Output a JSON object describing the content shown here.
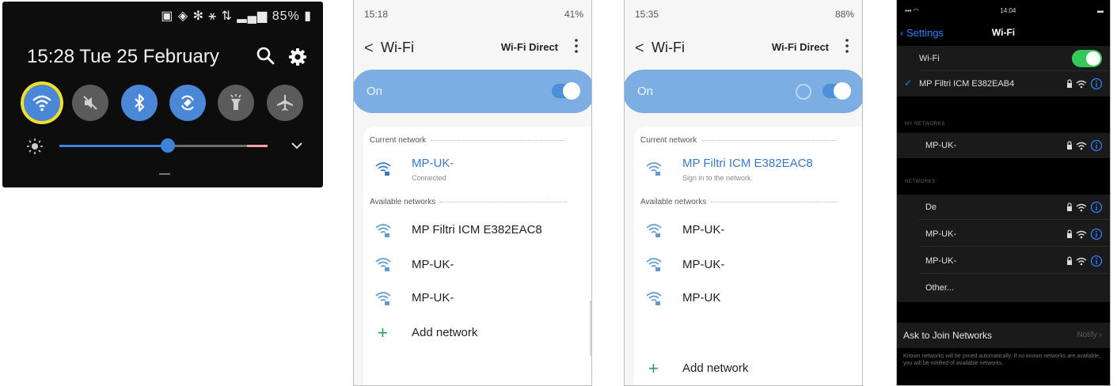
{
  "quick_settings": {
    "status": "85%",
    "time_date": "15:28  Tue 25 February",
    "brightness_level": 0.57,
    "tiles": [
      {
        "name": "wifi",
        "state": "on",
        "highlighted": true
      },
      {
        "name": "sound",
        "state": "off"
      },
      {
        "name": "bluetooth",
        "state": "on"
      },
      {
        "name": "auto-rotate",
        "state": "on"
      },
      {
        "name": "flashlight",
        "state": "off"
      },
      {
        "name": "airplane-mode",
        "state": "off"
      }
    ],
    "accent": "#4a87d6",
    "highlight": "#f3df27"
  },
  "screen_a": {
    "status_left": "15:18",
    "status_right": "41%",
    "back": "<",
    "title": "Wi-Fi",
    "wifi_direct": "Wi-Fi Direct",
    "on_label": "On",
    "current_network_header": "Current network",
    "current": {
      "name": "MP-UK-",
      "status": "Connected"
    },
    "available_header": "Available networks",
    "networks": [
      "MP Filtri ICM E382EAC8",
      "MP-UK-",
      "MP-UK-"
    ],
    "add_network": "Add network"
  },
  "screen_b": {
    "status_left": "15:35",
    "status_right": "88%",
    "back": "<",
    "title": "Wi-Fi",
    "wifi_direct": "Wi-Fi Direct",
    "on_label": "On",
    "current_network_header": "Current network",
    "current": {
      "name": "MP Filtri ICM E382EAC8",
      "status": "Sign in to the network."
    },
    "available_header": "Available networks",
    "networks": [
      "MP-UK-",
      "MP-UK-",
      "MP-UK"
    ],
    "add_network": "Add network"
  },
  "ios": {
    "status_time": "14:04",
    "back": "Settings",
    "title": "Wi-Fi",
    "wifi_label": "Wi-Fi",
    "connected": "MP Filtri ICM E382EAB4",
    "my_networks_header": "MY NETWORKS",
    "my_networks": [
      "MP-UK-"
    ],
    "networks_header": "NETWORKS",
    "networks": [
      "De",
      "MP-UK-",
      "MP-UK-",
      "Other..."
    ],
    "ask_label": "Ask to Join Networks",
    "ask_value": "Notify",
    "footer": "Known networks will be joined automatically. If no known networks are available, you will be notified of available networks.",
    "switch_color": "#35c759",
    "link_color": "#2f7fff"
  }
}
